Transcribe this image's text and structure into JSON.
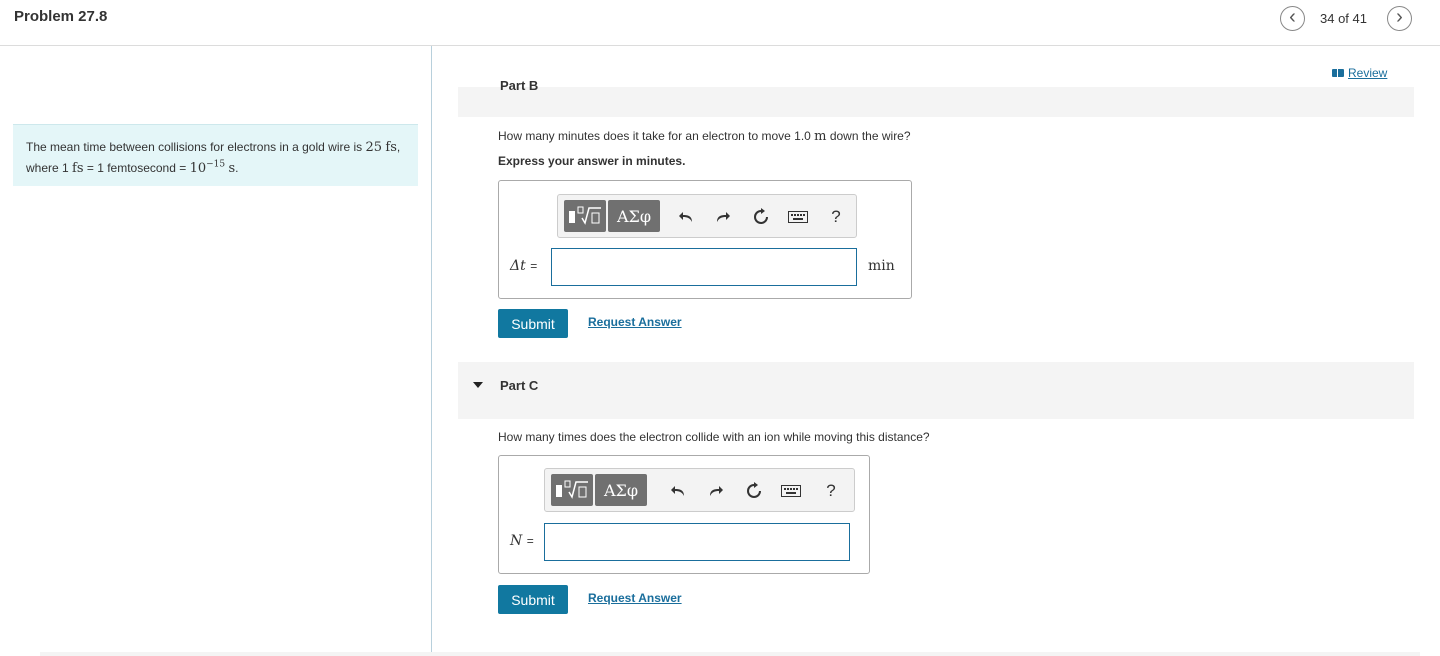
{
  "header": {
    "title": "Problem 27.8",
    "counter": "34 of 41",
    "prev_icon": "chevron-left-icon",
    "next_icon": "chevron-right-icon",
    "prev_glyph": "‹",
    "next_glyph": "›"
  },
  "problem": {
    "text_1": "The mean time between collisions for electrons in a gold wire is ",
    "val_25": "25",
    "unit_fs": "fs",
    "text_2": ", where 1 ",
    "text_3": " = 1 femtosecond = ",
    "pow_base": "10",
    "pow_exp": "−15",
    "unit_s": "s",
    "end": "."
  },
  "review": {
    "label": "Review",
    "icon": "book-icon"
  },
  "colors": {
    "accent": "#1178a0",
    "link": "#1a6e9c",
    "problem_bg": "#e4f6f8"
  },
  "part_b": {
    "label": "Part B",
    "question_1": "How many minutes does it take for an electron to move 1.0 ",
    "question_m": "m",
    "question_2": " down the wire?",
    "instruction": "Express your answer in minutes.",
    "toolbar": {
      "greek": "ΑΣφ",
      "help": "?"
    },
    "variable": "Δt",
    "equals": "=",
    "input_value": "",
    "unit": "min",
    "submit": "Submit",
    "request": "Request Answer"
  },
  "part_c": {
    "label": "Part C",
    "question": "How many times does the electron collide with an ion while moving this distance?",
    "toolbar": {
      "greek": "ΑΣφ",
      "help": "?"
    },
    "variable": "N",
    "equals": "=",
    "input_value": "",
    "submit": "Submit",
    "request": "Request Answer"
  }
}
